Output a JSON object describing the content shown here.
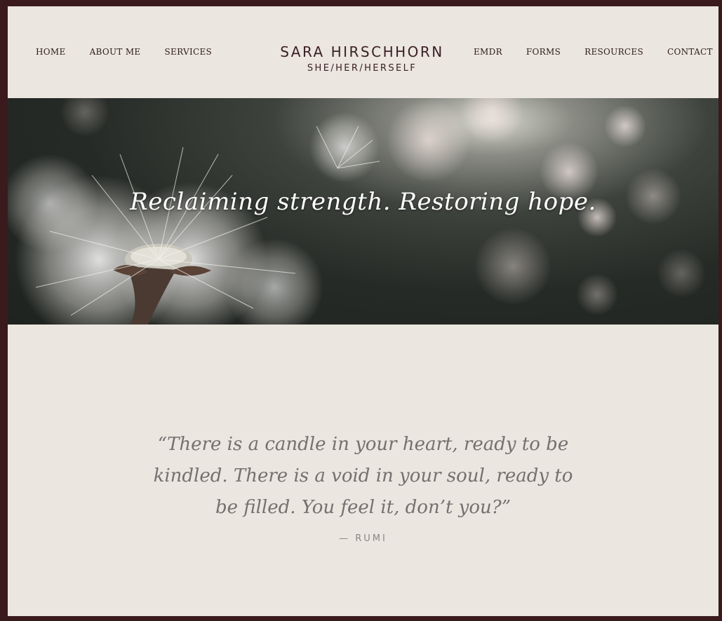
{
  "nav": {
    "left": [
      {
        "label": "HOME"
      },
      {
        "label": "ABOUT ME"
      },
      {
        "label": "SERVICES"
      }
    ],
    "right": [
      {
        "label": "EMDR"
      },
      {
        "label": "FORMS"
      },
      {
        "label": "RESOURCES"
      },
      {
        "label": "CONTACT"
      }
    ]
  },
  "brand": {
    "name": "SARA HIRSCHHORN",
    "pronouns": "SHE/HER/HERSELF"
  },
  "hero": {
    "headline": "Reclaiming strength. Restoring hope."
  },
  "quote": {
    "text": "“There is a candle in your heart, ready to be kindled. There is a void in your soul, ready to be filled. You feel it, don’t you?”",
    "attribution": "— RUMI"
  },
  "colors": {
    "frame": "#3a1a1c",
    "background": "#ebe6df",
    "brand_text": "#3a1f22",
    "quote_text": "#737170"
  }
}
